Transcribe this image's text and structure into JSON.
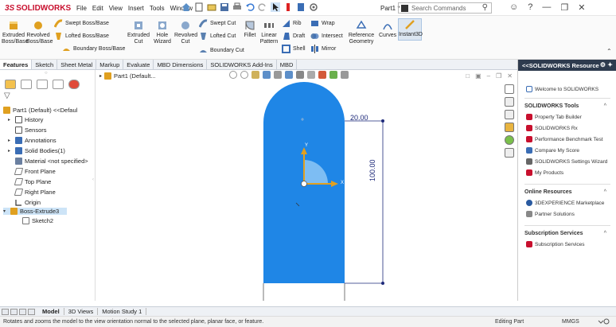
{
  "app": {
    "logo_ds": "3S",
    "logo_text": "SOLIDWORKS",
    "part_title": "Part1 *"
  },
  "menu": [
    "File",
    "Edit",
    "View",
    "Insert",
    "Tools",
    "Window"
  ],
  "search": {
    "placeholder": "Search Commands"
  },
  "commands": {
    "extruded_boss": "Extruded Boss/Base",
    "revolved_boss": "Revolved Boss/Base",
    "swept_boss": "Swept Boss/Base",
    "lofted_boss": "Lofted Boss/Base",
    "boundary_boss": "Boundary Boss/Base",
    "extruded_cut": "Extruded Cut",
    "hole_wizard": "Hole Wizard",
    "revolved_cut": "Revolved Cut",
    "swept_cut": "Swept Cut",
    "lofted_cut": "Lofted Cut",
    "boundary_cut": "Boundary Cut",
    "fillet": "Fillet",
    "linear_pattern": "Linear Pattern",
    "rib": "Rib",
    "draft": "Draft",
    "shell": "Shell",
    "wrap": "Wrap",
    "intersect": "Intersect",
    "mirror": "Mirror",
    "reference_geometry": "Reference Geometry",
    "curves": "Curves",
    "instant3d": "Instant3D"
  },
  "tabs": [
    "Features",
    "Sketch",
    "Sheet Metal",
    "Markup",
    "Evaluate",
    "MBD Dimensions",
    "SOLIDWORKS Add-Ins",
    "MBD"
  ],
  "tree": {
    "root": "Part1 (Default) <<Defaul",
    "items": [
      {
        "label": "History"
      },
      {
        "label": "Sensors"
      },
      {
        "label": "Annotations"
      },
      {
        "label": "Solid Bodies(1)"
      },
      {
        "label": "Material <not specified>"
      },
      {
        "label": "Front Plane"
      },
      {
        "label": "Top Plane"
      },
      {
        "label": "Right Plane"
      },
      {
        "label": "Origin"
      },
      {
        "label": "Boss-Extrude3"
      },
      {
        "label": "Sketch2"
      }
    ]
  },
  "viewport": {
    "part_label": "Part1 (Default..."
  },
  "dimensions": {
    "width": "20.00",
    "height": "100.00"
  },
  "taskpane": {
    "title": "<<SOLIDWORKS Resource",
    "welcome": "Welcome to SOLIDWORKS",
    "tools_title": "SOLIDWORKS Tools",
    "tools": [
      "Property Tab Builder",
      "SOLIDWORKS Rx",
      "Performance Benchmark Test",
      "Compare My Score",
      "SOLIDWORKS Settings Wizard",
      "My Products"
    ],
    "online_title": "Online Resources",
    "online": [
      "3DEXPERIENCE Marketplace",
      "Partner Solutions"
    ],
    "subscription_title": "Subscription Services",
    "subscription": [
      "Subscription Services"
    ]
  },
  "bottom_tabs": [
    "Model",
    "3D Views",
    "Motion Study 1"
  ],
  "status": {
    "message": "Rotates and zooms the model to the view orientation normal to the selected plane, planar face, or feature.",
    "state": "Editing Part",
    "units": "MMGS"
  },
  "colors": {
    "body_fill": "#1f86e6",
    "sw_red": "#c8102e",
    "dim_blue": "#1e2a7a"
  }
}
